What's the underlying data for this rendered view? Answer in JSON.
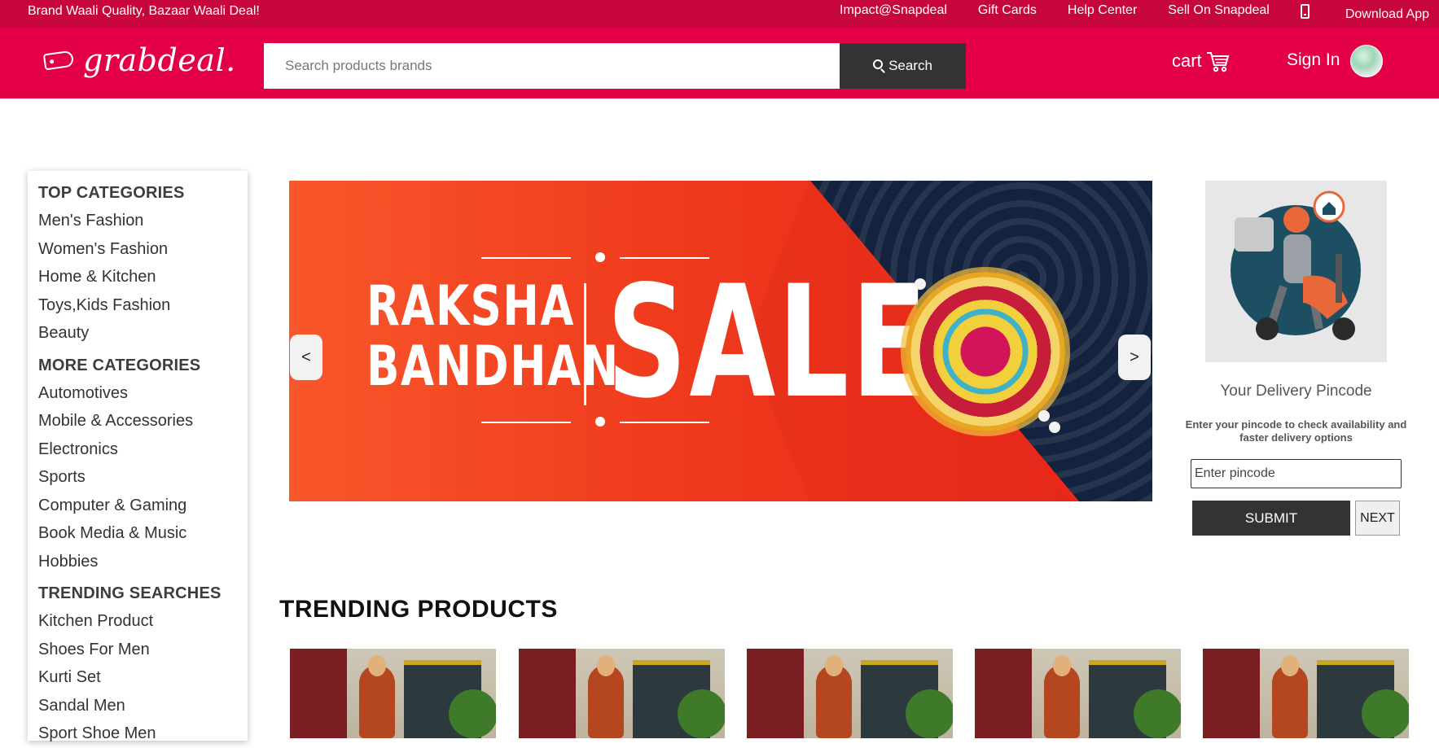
{
  "topbar": {
    "promo": "Brand Waali Quality, Bazaar Waali Deal!",
    "links": [
      "Impact@Snapdeal",
      "Gift Cards",
      "Help Center",
      "Sell On Snapdeal"
    ],
    "download_app": "Download App"
  },
  "header": {
    "logo": "grabdeal.",
    "search_placeholder": "Search products brands",
    "search_button": "Search",
    "cart_label": "cart",
    "signin_label": "Sign In"
  },
  "sidebar": {
    "sections": [
      {
        "title": "TOP CATEGORIES",
        "items": [
          "Men's Fashion",
          "Women's Fashion",
          "Home & Kitchen",
          "Toys,Kids Fashion",
          "Beauty"
        ]
      },
      {
        "title": "MORE CATEGORIES",
        "items": [
          "Automotives",
          "Mobile & Accessories",
          "Electronics",
          "Sports",
          "Computer & Gaming",
          "Book Media & Music",
          "Hobbies"
        ]
      },
      {
        "title": "TRENDING SEARCHES",
        "items": [
          "Kitchen Product",
          "Shoes For Men",
          "Kurti Set",
          "Sandal Men",
          "Sport Shoe Men"
        ]
      }
    ]
  },
  "banner": {
    "line1": "RAKSHA",
    "line2": "BANDHAN",
    "big": "SALE",
    "prev": "<",
    "next": ">"
  },
  "delivery": {
    "title": "Your Delivery Pincode",
    "description": "Enter your pincode to check availability and faster delivery options",
    "placeholder": "Enter pincode",
    "submit": "SUBMIT",
    "next": "NEXT"
  },
  "trending": {
    "title": "TRENDING PRODUCTS",
    "product_count": 5
  }
}
